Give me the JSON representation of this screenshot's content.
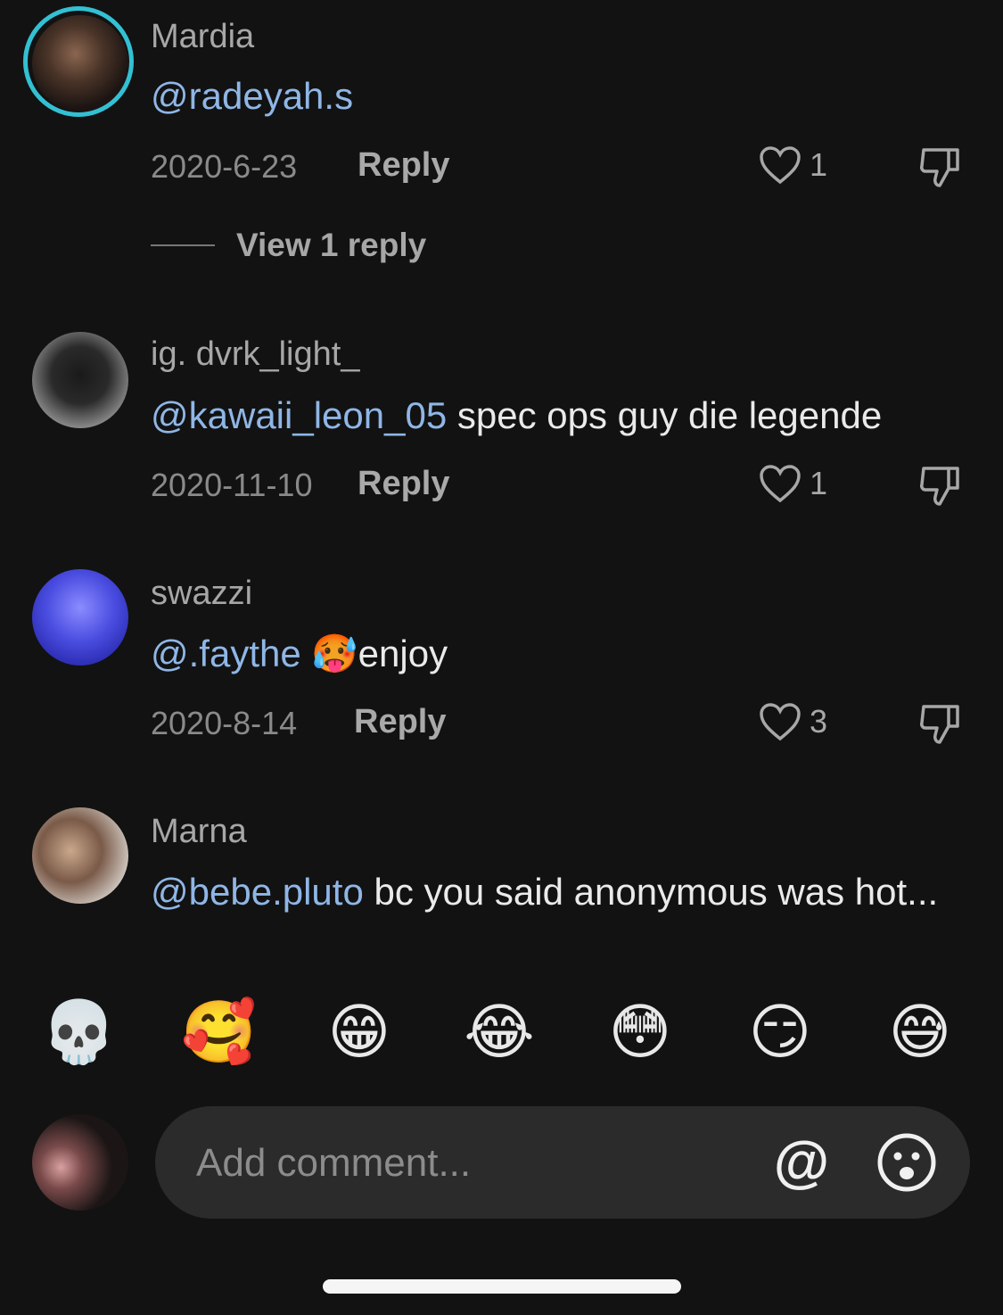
{
  "comments": [
    {
      "username": "Mardia",
      "mention": "@radeyah.s",
      "text": "",
      "date": "2020-6-23",
      "reply_label": "Reply",
      "likes": "1",
      "view_replies": "View 1 reply"
    },
    {
      "username": "ig. dvrk_light_",
      "mention": "@kawaii_leon_05",
      "text": " spec ops guy die legende",
      "date": "2020-11-10",
      "reply_label": "Reply",
      "likes": "1"
    },
    {
      "username": "swazzi",
      "mention": "@.faythe",
      "text": " 🥵enjoy",
      "date": "2020-8-14",
      "reply_label": "Reply",
      "likes": "3"
    },
    {
      "username": "Marna",
      "mention": "@bebe.pluto",
      "text": " bc you said anonymous was hot...",
      "date": "",
      "reply_label": "",
      "likes": ""
    }
  ],
  "quick_emojis": [
    "💀",
    "🥰",
    "😁",
    "😂",
    "😳",
    "😏",
    "😅"
  ],
  "composer": {
    "placeholder": "Add comment...",
    "mention_icon": "@"
  },
  "colors": {
    "background": "#121212",
    "mention": "#8fb6e6",
    "story_ring": "#33c0d3"
  }
}
